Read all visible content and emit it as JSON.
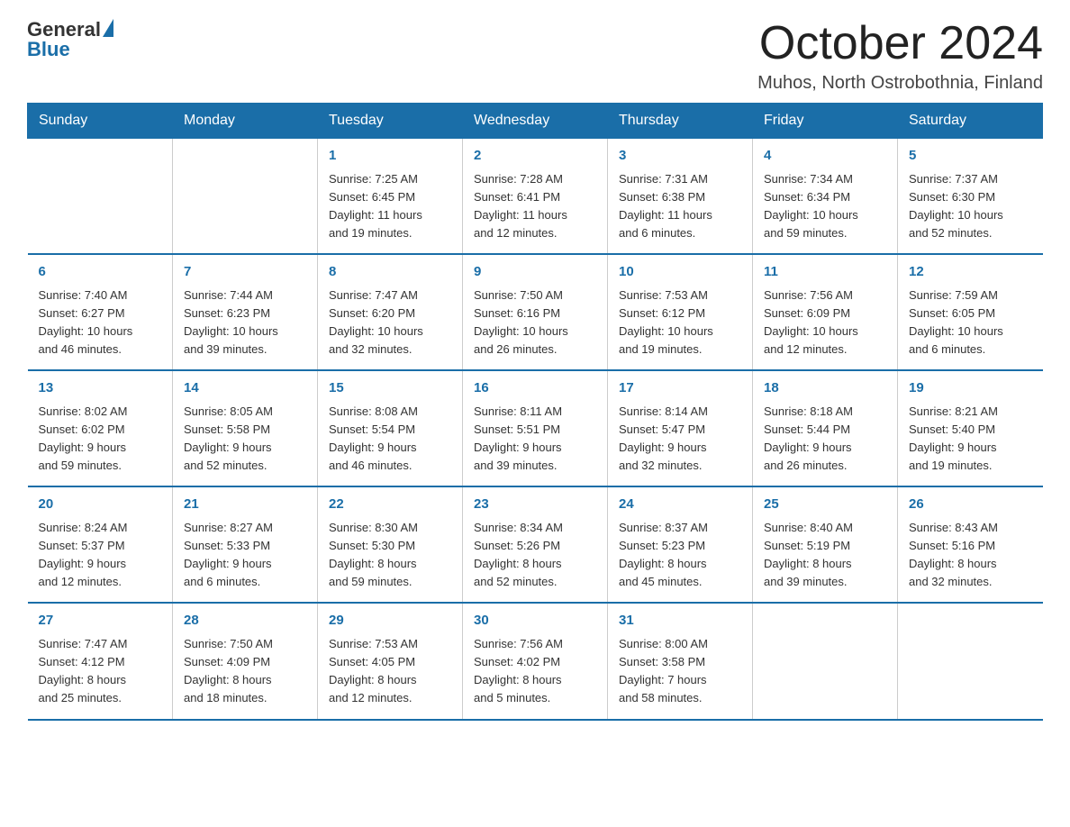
{
  "logo": {
    "general": "General",
    "blue": "Blue"
  },
  "header": {
    "month": "October 2024",
    "location": "Muhos, North Ostrobothnia, Finland"
  },
  "weekdays": [
    "Sunday",
    "Monday",
    "Tuesday",
    "Wednesday",
    "Thursday",
    "Friday",
    "Saturday"
  ],
  "weeks": [
    [
      {
        "day": "",
        "info": ""
      },
      {
        "day": "",
        "info": ""
      },
      {
        "day": "1",
        "info": "Sunrise: 7:25 AM\nSunset: 6:45 PM\nDaylight: 11 hours\nand 19 minutes."
      },
      {
        "day": "2",
        "info": "Sunrise: 7:28 AM\nSunset: 6:41 PM\nDaylight: 11 hours\nand 12 minutes."
      },
      {
        "day": "3",
        "info": "Sunrise: 7:31 AM\nSunset: 6:38 PM\nDaylight: 11 hours\nand 6 minutes."
      },
      {
        "day": "4",
        "info": "Sunrise: 7:34 AM\nSunset: 6:34 PM\nDaylight: 10 hours\nand 59 minutes."
      },
      {
        "day": "5",
        "info": "Sunrise: 7:37 AM\nSunset: 6:30 PM\nDaylight: 10 hours\nand 52 minutes."
      }
    ],
    [
      {
        "day": "6",
        "info": "Sunrise: 7:40 AM\nSunset: 6:27 PM\nDaylight: 10 hours\nand 46 minutes."
      },
      {
        "day": "7",
        "info": "Sunrise: 7:44 AM\nSunset: 6:23 PM\nDaylight: 10 hours\nand 39 minutes."
      },
      {
        "day": "8",
        "info": "Sunrise: 7:47 AM\nSunset: 6:20 PM\nDaylight: 10 hours\nand 32 minutes."
      },
      {
        "day": "9",
        "info": "Sunrise: 7:50 AM\nSunset: 6:16 PM\nDaylight: 10 hours\nand 26 minutes."
      },
      {
        "day": "10",
        "info": "Sunrise: 7:53 AM\nSunset: 6:12 PM\nDaylight: 10 hours\nand 19 minutes."
      },
      {
        "day": "11",
        "info": "Sunrise: 7:56 AM\nSunset: 6:09 PM\nDaylight: 10 hours\nand 12 minutes."
      },
      {
        "day": "12",
        "info": "Sunrise: 7:59 AM\nSunset: 6:05 PM\nDaylight: 10 hours\nand 6 minutes."
      }
    ],
    [
      {
        "day": "13",
        "info": "Sunrise: 8:02 AM\nSunset: 6:02 PM\nDaylight: 9 hours\nand 59 minutes."
      },
      {
        "day": "14",
        "info": "Sunrise: 8:05 AM\nSunset: 5:58 PM\nDaylight: 9 hours\nand 52 minutes."
      },
      {
        "day": "15",
        "info": "Sunrise: 8:08 AM\nSunset: 5:54 PM\nDaylight: 9 hours\nand 46 minutes."
      },
      {
        "day": "16",
        "info": "Sunrise: 8:11 AM\nSunset: 5:51 PM\nDaylight: 9 hours\nand 39 minutes."
      },
      {
        "day": "17",
        "info": "Sunrise: 8:14 AM\nSunset: 5:47 PM\nDaylight: 9 hours\nand 32 minutes."
      },
      {
        "day": "18",
        "info": "Sunrise: 8:18 AM\nSunset: 5:44 PM\nDaylight: 9 hours\nand 26 minutes."
      },
      {
        "day": "19",
        "info": "Sunrise: 8:21 AM\nSunset: 5:40 PM\nDaylight: 9 hours\nand 19 minutes."
      }
    ],
    [
      {
        "day": "20",
        "info": "Sunrise: 8:24 AM\nSunset: 5:37 PM\nDaylight: 9 hours\nand 12 minutes."
      },
      {
        "day": "21",
        "info": "Sunrise: 8:27 AM\nSunset: 5:33 PM\nDaylight: 9 hours\nand 6 minutes."
      },
      {
        "day": "22",
        "info": "Sunrise: 8:30 AM\nSunset: 5:30 PM\nDaylight: 8 hours\nand 59 minutes."
      },
      {
        "day": "23",
        "info": "Sunrise: 8:34 AM\nSunset: 5:26 PM\nDaylight: 8 hours\nand 52 minutes."
      },
      {
        "day": "24",
        "info": "Sunrise: 8:37 AM\nSunset: 5:23 PM\nDaylight: 8 hours\nand 45 minutes."
      },
      {
        "day": "25",
        "info": "Sunrise: 8:40 AM\nSunset: 5:19 PM\nDaylight: 8 hours\nand 39 minutes."
      },
      {
        "day": "26",
        "info": "Sunrise: 8:43 AM\nSunset: 5:16 PM\nDaylight: 8 hours\nand 32 minutes."
      }
    ],
    [
      {
        "day": "27",
        "info": "Sunrise: 7:47 AM\nSunset: 4:12 PM\nDaylight: 8 hours\nand 25 minutes."
      },
      {
        "day": "28",
        "info": "Sunrise: 7:50 AM\nSunset: 4:09 PM\nDaylight: 8 hours\nand 18 minutes."
      },
      {
        "day": "29",
        "info": "Sunrise: 7:53 AM\nSunset: 4:05 PM\nDaylight: 8 hours\nand 12 minutes."
      },
      {
        "day": "30",
        "info": "Sunrise: 7:56 AM\nSunset: 4:02 PM\nDaylight: 8 hours\nand 5 minutes."
      },
      {
        "day": "31",
        "info": "Sunrise: 8:00 AM\nSunset: 3:58 PM\nDaylight: 7 hours\nand 58 minutes."
      },
      {
        "day": "",
        "info": ""
      },
      {
        "day": "",
        "info": ""
      }
    ]
  ]
}
